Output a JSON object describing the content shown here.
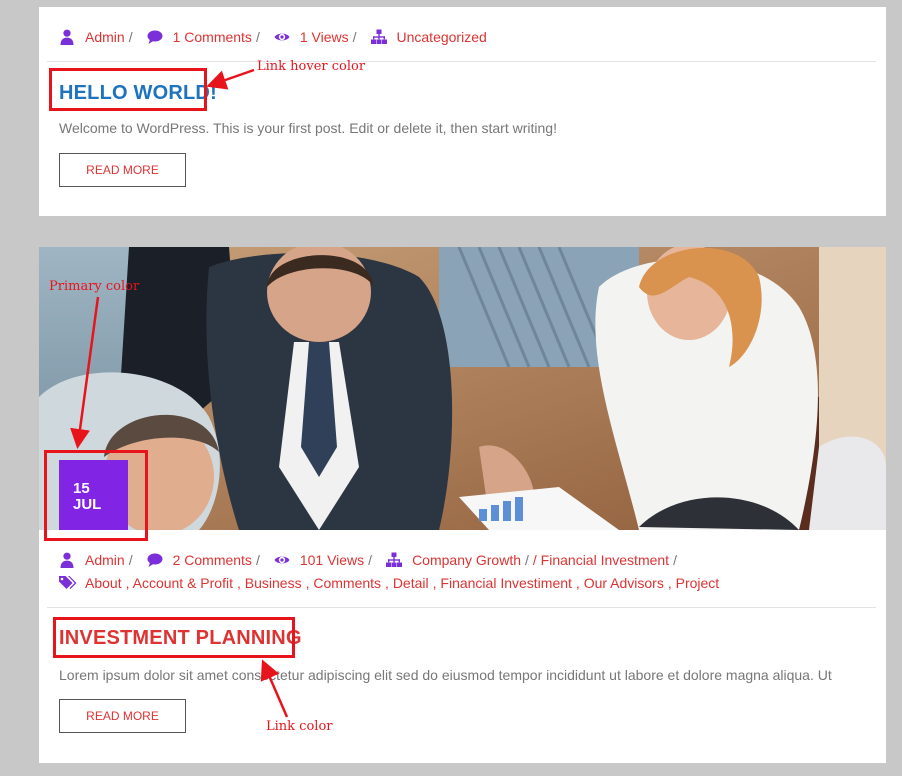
{
  "colors": {
    "background": "#c8c8c8",
    "primary": "#8224e3",
    "link": "#dd3333",
    "link_hover": "#1e73be",
    "annotation": "#e8141c"
  },
  "post1": {
    "meta": {
      "author": "Admin",
      "comments": "1 Comments",
      "views": "1 Views",
      "category": "Uncategorized"
    },
    "title": "HELLO WORLD!",
    "excerpt": "Welcome to WordPress. This is your first post. Edit or delete it, then start writing!",
    "read_more": "READ MORE"
  },
  "post2": {
    "date_day": "15",
    "date_month": "JUL",
    "meta": {
      "author": "Admin",
      "comments": "2 Comments",
      "views": "101 Views",
      "category_1": "Company Growth",
      "category_2": "/ Financial Investment"
    },
    "tags": [
      "About",
      ", Account & Profit",
      ", Business",
      ", Comments",
      ", Detail",
      ", Financial Investiment",
      ", Our Advisors",
      ", Project"
    ],
    "title": "INVESTMENT PLANNING",
    "excerpt": "Lorem ipsum dolor sit amet consectetur adipiscing elit sed do eiusmod tempor incididunt ut labore et dolore magna aliqua. Ut",
    "read_more": "READ MORE"
  },
  "annotations": {
    "link_hover_color": "Link hover color",
    "primary_color": "Primary color",
    "link_color": "Link color"
  },
  "separator": "/",
  "icons": {
    "author": "user-icon",
    "comments": "comment-icon",
    "views": "eye-icon",
    "category": "sitemap-icon",
    "tags": "tags-icon"
  }
}
